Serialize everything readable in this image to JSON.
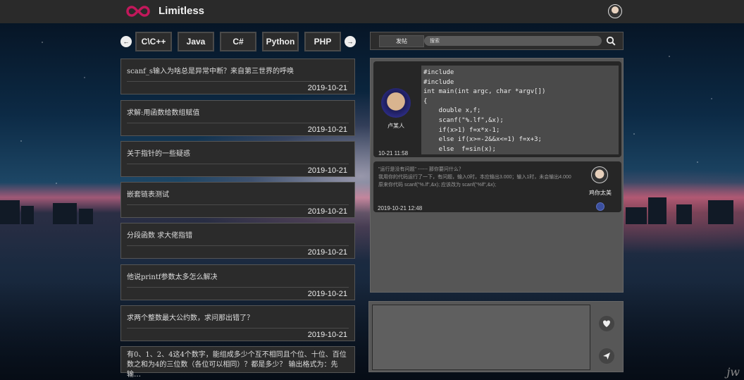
{
  "header": {
    "brand": "Limitless"
  },
  "tabs": [
    {
      "label": "C\\C++"
    },
    {
      "label": "Java"
    },
    {
      "label": "C#"
    },
    {
      "label": "Python"
    },
    {
      "label": "PHP"
    }
  ],
  "posts": [
    {
      "title": "scanf_s输入为啥总是异常中断？来自第三世界的呼唤",
      "date": "2019-10-21"
    },
    {
      "title": "求解:用函数给数组赋值",
      "date": "2019-10-21"
    },
    {
      "title": "关于指针的一些疑惑",
      "date": "2019-10-21"
    },
    {
      "title": "嵌套链表测试",
      "date": "2019-10-21"
    },
    {
      "title": "分段函数 求大佬指错",
      "date": "2019-10-21"
    },
    {
      "title": "他说printf参数太多怎么解决",
      "date": "2019-10-21"
    },
    {
      "title": "求两个整数最大公约数，求问那出错了？",
      "date": "2019-10-21"
    },
    {
      "title": "有0、1、2、4这4个数字，能组成多少个互不相同且个位、十位、百位数之和为4的三位数（各位可以相同）？都是多少？ 输出格式为：先输…"
    }
  ],
  "toolbar": {
    "post_label": "发帖",
    "search_placeholder": "搜索"
  },
  "thread": {
    "author": "卢某人",
    "time": "10-21 11:58",
    "code": "#include\n#include\nint main(int argc, char *argv[])\n{\n    double x,f;\n    scanf(\"%.lf\",&x);\n    if(x>1) f=x*x-1;\n    else if(x>=-2&&x<=1) f=x+3;\n    else  f=sin(x);",
    "reply": {
      "text": "\"运行是没有问题\" ------ 那你要问什么？\n我用你的代码运行了一下，有问题，输入0时，本应输出3.000；输入1时，未会输出4.000\n原来你代码 scanf(\"%.lf\",&x); 应该改为 scanf(\"%lf\",&x);",
      "author": "鸡你太美",
      "time": "2019-10-21 12:48"
    }
  },
  "corner_text": "jw"
}
